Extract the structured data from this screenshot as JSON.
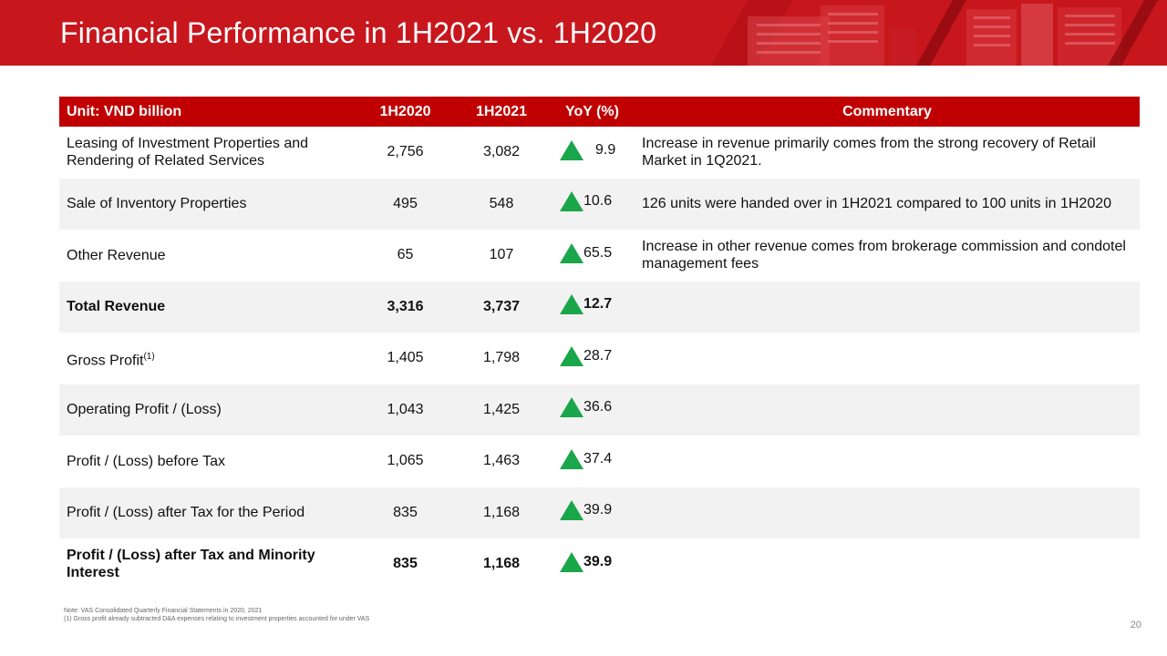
{
  "header": {
    "title": "Financial Performance in 1H2021 vs. 1H2020"
  },
  "colors": {
    "header_bg": "#c8161d",
    "table_header_bg": "#c00000",
    "row_alt_bg": "#f2f2f2",
    "up_arrow": "#1aa64a"
  },
  "table": {
    "headers": {
      "item": "Unit: VND billion",
      "h2020": "1H2020",
      "h2021": "1H2021",
      "yoy": "YoY (%)",
      "commentary": "Commentary"
    },
    "rows": [
      {
        "item": "Leasing of Investment Properties and Rendering of Related Services",
        "h2020": "2,756",
        "h2021": "3,082",
        "yoy": "9.9",
        "trend": "up-arrow-icon",
        "commentary": "Increase in revenue primarily comes from the strong recovery of Retail Market in 1Q2021."
      },
      {
        "item": "Sale of Inventory Properties",
        "h2020": "495",
        "h2021": "548",
        "yoy": "10.6",
        "trend": "up-arrow-icon",
        "commentary": "126 units were handed over in 1H2021 compared to 100 units in 1H2020"
      },
      {
        "item": "Other Revenue",
        "h2020": "65",
        "h2021": "107",
        "yoy": "65.5",
        "trend": "up-arrow-icon",
        "commentary": "Increase in other revenue comes from brokerage commission and condotel management fees"
      },
      {
        "item": "Total Revenue",
        "h2020": "3,316",
        "h2021": "3,737",
        "yoy": "12.7",
        "trend": "up-arrow-icon",
        "commentary": ""
      },
      {
        "item": "Gross Profit",
        "item_sup": "(1)",
        "h2020": "1,405",
        "h2021": "1,798",
        "yoy": "28.7",
        "trend": "up-arrow-icon",
        "commentary": ""
      },
      {
        "item": "Operating Profit / (Loss)",
        "h2020": "1,043",
        "h2021": "1,425",
        "yoy": "36.6",
        "trend": "up-arrow-icon",
        "commentary": ""
      },
      {
        "item": "Profit / (Loss) before Tax",
        "h2020": "1,065",
        "h2021": "1,463",
        "yoy": "37.4",
        "trend": "up-arrow-icon",
        "commentary": ""
      },
      {
        "item": "Profit / (Loss) after Tax for the Period",
        "h2020": "835",
        "h2021": "1,168",
        "yoy": "39.9",
        "trend": "up-arrow-icon",
        "commentary": ""
      },
      {
        "item": "Profit / (Loss) after Tax and Minority Interest",
        "h2020": "835",
        "h2021": "1,168",
        "yoy": "39.9",
        "trend": "up-arrow-icon",
        "commentary": ""
      }
    ]
  },
  "notes": {
    "line1": "Note: VAS Consolidated Quarterly Financial Statements in 2020, 2021",
    "line2": "(1) Gross profit already subtracted D&A expenses relating to investment properties accounted for under VAS"
  },
  "page_number": "20"
}
